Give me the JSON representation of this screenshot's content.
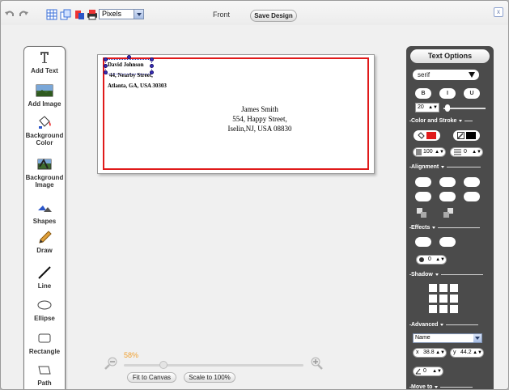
{
  "toolbar": {
    "unit_value": "Pixels",
    "view_label": "Front",
    "save_label": "Save Design",
    "close_glyph": "x",
    "icons": [
      "undo-icon",
      "redo-icon",
      "grid-icon",
      "copy-icon",
      "layers-icon",
      "print-icon"
    ]
  },
  "tools": [
    {
      "label": "Add Text",
      "icon": "text-icon"
    },
    {
      "label": "Add Image",
      "icon": "image-icon"
    },
    {
      "label": "Background Color",
      "icon": "paint-bucket-icon"
    },
    {
      "label": "Background Image",
      "icon": "background-image-icon"
    },
    {
      "label": "Shapes",
      "icon": "shapes-icon"
    },
    {
      "label": "Draw",
      "icon": "pencil-icon"
    },
    {
      "label": "Line",
      "icon": "line-icon"
    },
    {
      "label": "Ellipse",
      "icon": "ellipse-icon"
    },
    {
      "label": "Rectangle",
      "icon": "rectangle-icon"
    },
    {
      "label": "Path",
      "icon": "path-icon"
    }
  ],
  "canvas": {
    "sender": {
      "name": "David Johnson",
      "street": "44, Nearby Street,",
      "city": "Atlanta, GA, USA 30303"
    },
    "recipient": {
      "name": "James Smith",
      "street": "554, Happy Street,",
      "city": "Iselin,NJ, USA 08830"
    },
    "frame_color": "#e01a1a"
  },
  "zoom": {
    "percent_label": "58%",
    "level": 0.58,
    "fit_label": "Fit to Canvas",
    "scale_label": "Scale to 100%"
  },
  "text_options": {
    "title": "Text Options",
    "font_family": "serif",
    "bold": "B",
    "italic": "I",
    "underline": "U",
    "font_size": "20",
    "color_stroke_label": "Color and Stroke",
    "fill_color": "#e01a1a",
    "stroke_color": "#000000",
    "opacity": "100",
    "stroke_width": "0",
    "alignment_label": "Alignment",
    "effects_label": "Effects",
    "effect_value": "0",
    "shadow_label": "Shadow",
    "advanced_label": "Advanced",
    "name_value": "Name",
    "x_label": "x",
    "x_value": "38.8",
    "y_label": "y",
    "y_value": "44.2",
    "angle_value": "0",
    "move_to_label": "Move to"
  }
}
